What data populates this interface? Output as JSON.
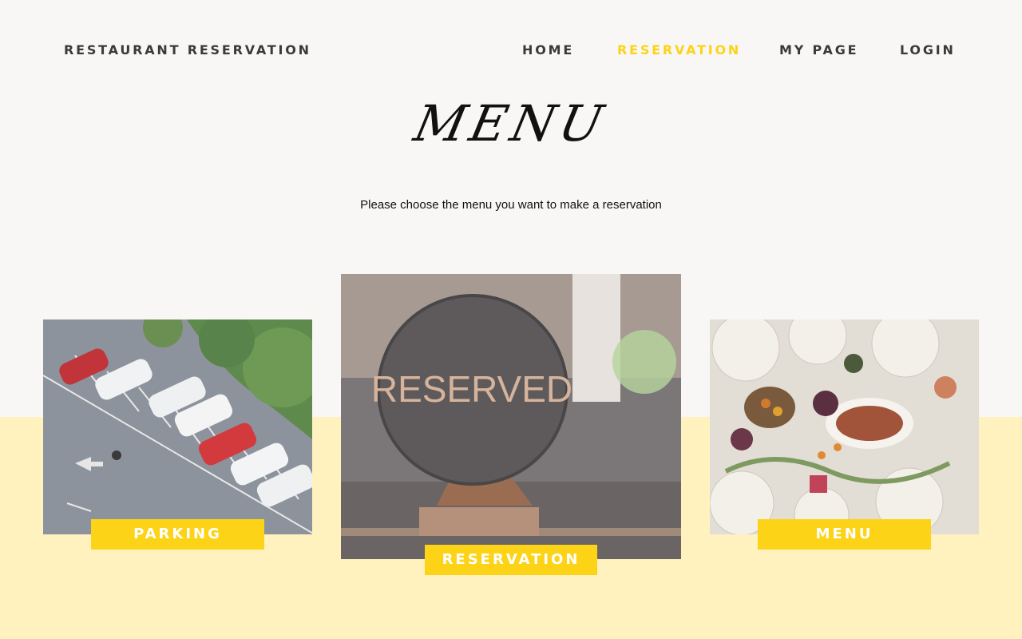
{
  "header": {
    "brand": "RESTAURANT RESERVATION",
    "nav": [
      {
        "label": "HOME",
        "active": false
      },
      {
        "label": "RESERVATION",
        "active": true
      },
      {
        "label": "MY PAGE",
        "active": false
      },
      {
        "label": "LOGIN",
        "active": false
      }
    ]
  },
  "main": {
    "title": "MENU",
    "subtitle": "Please choose the menu you want to make a reservation",
    "cards": [
      {
        "label": "PARKING",
        "image": "parking-lot-photo"
      },
      {
        "label": "RESERVATION",
        "image": "reserved-sign-photo",
        "sign_text": "RESERVED"
      },
      {
        "label": "MENU",
        "image": "dinner-table-photo"
      }
    ]
  },
  "colors": {
    "accent": "#fcd317",
    "background": "#f9f7f5",
    "band": "#fff2bf",
    "nav_text": "#3a3a3a"
  }
}
